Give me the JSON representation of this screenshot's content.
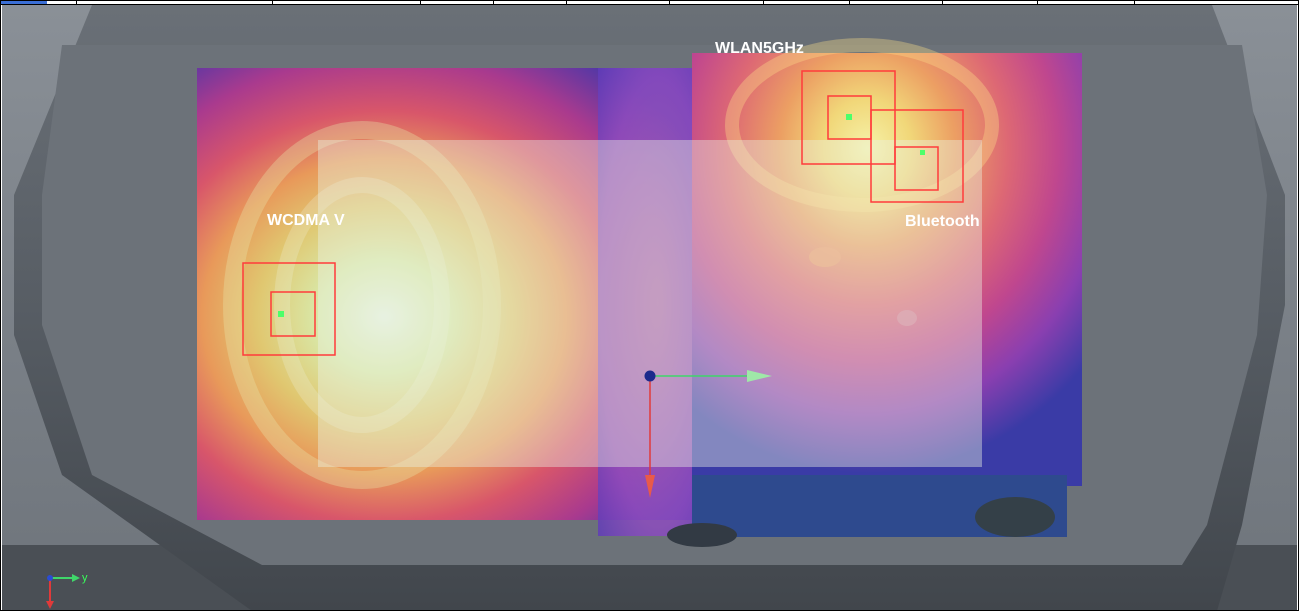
{
  "view": {
    "title": "",
    "labels": {
      "wcdma": "WCDMA V",
      "wlan": "WLAN5GHz",
      "bluetooth": "Bluetooth"
    },
    "axis_triad": {
      "y_label": "y"
    }
  },
  "colors": {
    "background_gray": "#7d848b",
    "device_outline": "#5e646b",
    "marker_box": "#ff3b3b",
    "peak_point": "#4dff6a",
    "axis_x": "#3fd66a",
    "axis_y": "#e03a3a",
    "origin": "#1c2a8c"
  },
  "icons": [
    "axis-origin-icon",
    "x-axis-arrow-icon",
    "y-axis-arrow-icon",
    "axis-triad-icon"
  ]
}
